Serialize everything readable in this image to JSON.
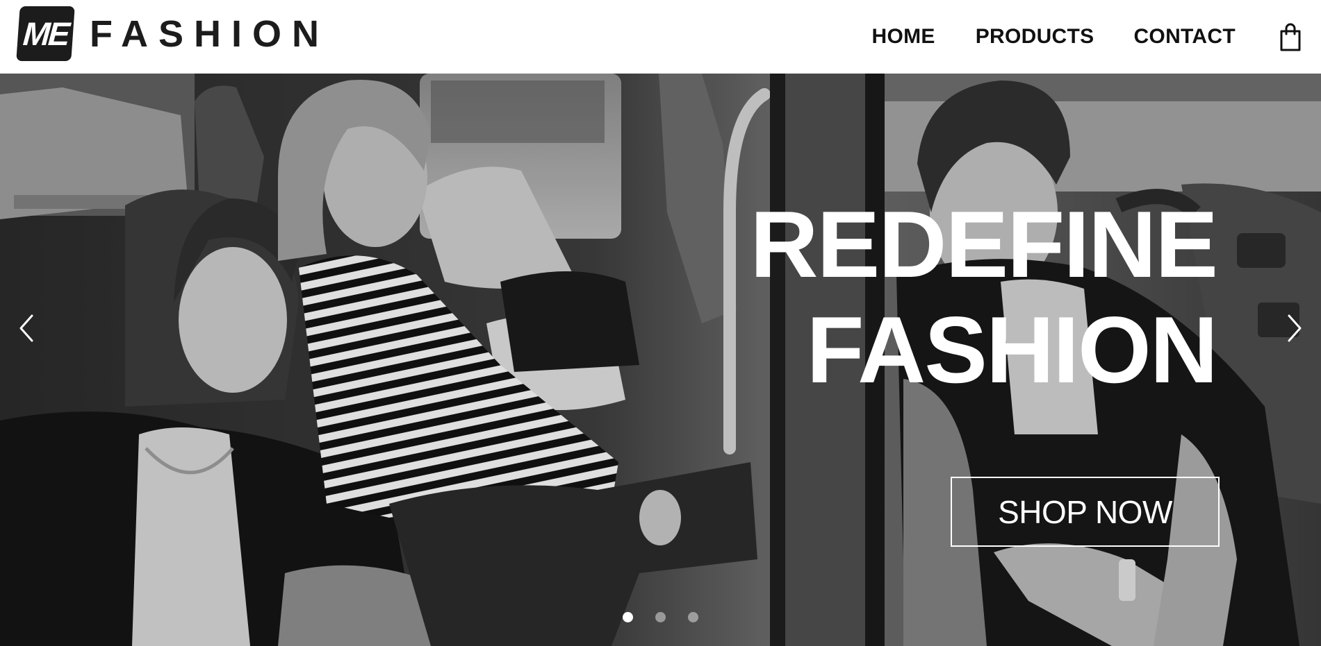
{
  "brand": {
    "badge_text": "ME",
    "name": "FASHION"
  },
  "nav": {
    "items": [
      {
        "label": "HOME"
      },
      {
        "label": "PRODUCTS"
      },
      {
        "label": "CONTACT"
      }
    ],
    "cart_icon": "shopping-bag-icon"
  },
  "hero": {
    "title_line1": "REDEFINE",
    "title_line2": "FASHION",
    "cta_label": "SHOP NOW",
    "prev_icon": "chevron-left-icon",
    "next_icon": "chevron-right-icon",
    "slides_total": 3,
    "active_slide": 1,
    "image_description_tone": "black-and-white"
  },
  "colors": {
    "header_bg": "#ffffff",
    "brand_dark": "#1c1c1c",
    "hero_text": "#ffffff"
  }
}
